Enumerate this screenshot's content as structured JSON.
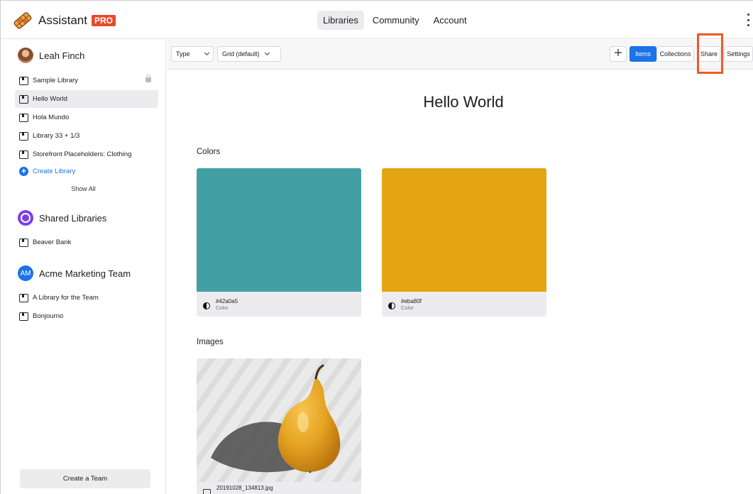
{
  "app": {
    "name": "Assistant",
    "badge": "PRO"
  },
  "topnav": {
    "items": [
      "Libraries",
      "Community",
      "Account"
    ],
    "active": "Libraries"
  },
  "sidebar": {
    "user": {
      "name": "Leah Finch"
    },
    "libraries": [
      {
        "label": "Sample Library",
        "locked": true
      },
      {
        "label": "Hello World",
        "selected": true
      },
      {
        "label": "Hola Mundo"
      },
      {
        "label": "Library 33 + 1/3"
      },
      {
        "label": "Storefront Placeholders: Clothing"
      }
    ],
    "create_library": "Create Library",
    "show_all": "Show All",
    "shared": {
      "title": "Shared Libraries",
      "libraries": [
        {
          "label": "Beaver Bank"
        }
      ]
    },
    "team": {
      "initials": "AM",
      "title": "Acme Marketing Team",
      "libraries": [
        {
          "label": "A Library for the Team"
        },
        {
          "label": "Bonjourno"
        }
      ]
    },
    "create_team": "Create a Team"
  },
  "toolbar": {
    "type_select": "Type",
    "view_select": "Grid (default)",
    "items": "Items",
    "collections": "Collections",
    "share": "Share",
    "settings": "Settings"
  },
  "main": {
    "title": "Hello World",
    "colors_section": "Colors",
    "colors": [
      {
        "name": "#42a0a5",
        "type": "Color",
        "hex": "#42a0a5"
      },
      {
        "name": "#eba80f",
        "type": "Color",
        "hex": "#e3a512"
      }
    ],
    "images_section": "Images",
    "images": [
      {
        "name": "20191028_134813.jpg"
      }
    ]
  },
  "icons": [
    "assistant-logo-icon",
    "kebab-menu-icon",
    "book-icon",
    "lock-icon",
    "add-circle-icon",
    "contrast-icon",
    "plus-icon",
    "chevron-down-icon",
    "image-icon"
  ],
  "colors": {
    "accent": "#1a73e8",
    "badge": "#e84a2a",
    "highlight": "#f05a24"
  }
}
